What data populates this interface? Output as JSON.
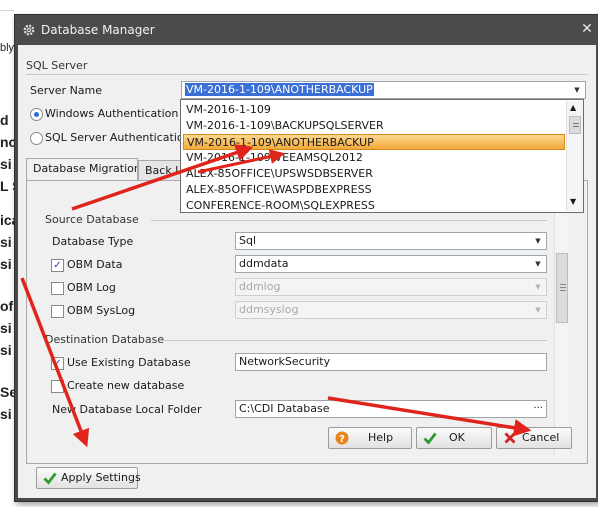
{
  "window": {
    "title": "Database Manager",
    "close_glyph": "✕",
    "icon": "gear-icon"
  },
  "background": {
    "fragments": [
      "bly",
      "d",
      "nc",
      "si",
      "L S",
      "ica",
      "si",
      "si",
      "of",
      "si",
      "si",
      "Se",
      "si"
    ]
  },
  "sql_server": {
    "group_title": "SQL Server",
    "server_name_label": "Server Name",
    "server_name_value": "VM-2016-1-109\\ANOTHERBACKUP",
    "auth_windows_label": "Windows Authentication",
    "auth_sql_label": "SQL Server Authentication",
    "auth_selected": "windows"
  },
  "server_dropdown": {
    "options": [
      "VM-2016-1-109",
      "VM-2016-1-109\\BACKUPSQLSERVER",
      "VM-2016-1-109\\ANOTHERBACKUP",
      "VM-2016-1-109\\VEEAMSQL2012",
      "ALEX-85OFFICE\\UPSWSDBSERVER",
      "ALEX-85OFFICE\\WASPDBEXPRESS",
      "CONFERENCE-ROOM\\SQLEXPRESS"
    ],
    "selected_index": 2
  },
  "tabs": [
    {
      "label": "Database Migration",
      "active": true
    },
    {
      "label": "Back Up",
      "active": false
    }
  ],
  "source_db": {
    "group_title": "Source Database",
    "db_type_label": "Database Type",
    "db_type_value": "Sql",
    "obm_data_label": "OBM Data",
    "obm_data_checked": true,
    "obm_data_value": "ddmdata",
    "obm_log_label": "OBM Log",
    "obm_log_checked": false,
    "obm_log_value": "ddmlog",
    "obm_syslog_label": "OBM SysLog",
    "obm_syslog_checked": false,
    "obm_syslog_value": "ddmsyslog"
  },
  "dest_db": {
    "group_title": "Destination Database",
    "use_existing_label": "Use Existing Database",
    "use_existing_checked": true,
    "use_existing_value": "NetworkSecurity",
    "create_new_label": "Create new database",
    "create_new_checked": false,
    "folder_label": "New Database Local Folder",
    "folder_value": "C:\\CDI Database",
    "browse_glyph": "···"
  },
  "buttons": {
    "help": "Help",
    "ok": "OK",
    "cancel": "Cancel",
    "apply": "Apply Settings"
  },
  "colors": {
    "titlebar": "#4b4b4b",
    "selection_highlight": "#f2a93a",
    "annotation_arrow": "#e0241b",
    "text_selection": "#3a70d6"
  }
}
